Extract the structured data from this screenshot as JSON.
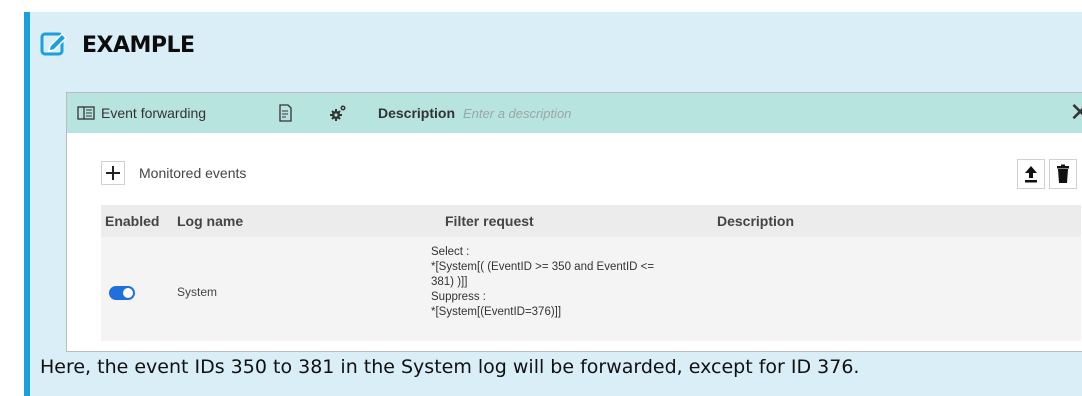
{
  "example": {
    "title": "EXAMPLE"
  },
  "toolbar": {
    "module_label": "Event forwarding",
    "description_label": "Description",
    "description_placeholder": "Enter a description",
    "close_glyph": "✕"
  },
  "monitored": {
    "add_label": "Monitored events"
  },
  "table": {
    "headers": [
      "Enabled",
      "Log name",
      "Filter request",
      "Description"
    ],
    "rows": [
      {
        "enabled": true,
        "log_name": "System",
        "filter_lines": [
          "Select :",
          "*[System[( (EventID >= 350 and EventID <=",
          "381) )]]",
          "Suppress :",
          "*[System[(EventID=376)]]"
        ],
        "description": ""
      }
    ]
  },
  "caption": "Here, the event IDs 350 to 381 in the System log will be forwarded, except for ID 376.",
  "colors": {
    "accent": "#1aa0dc",
    "toolbar_bg": "#b7e4de",
    "toggle_on": "#1f6fdc",
    "callout_bg": "#d9eef7"
  },
  "icons": [
    "edit-note-icon",
    "panel-layout-icon",
    "document-edit-icon",
    "gears-icon",
    "close-icon",
    "plus-icon",
    "upload-icon",
    "trash-icon"
  ]
}
